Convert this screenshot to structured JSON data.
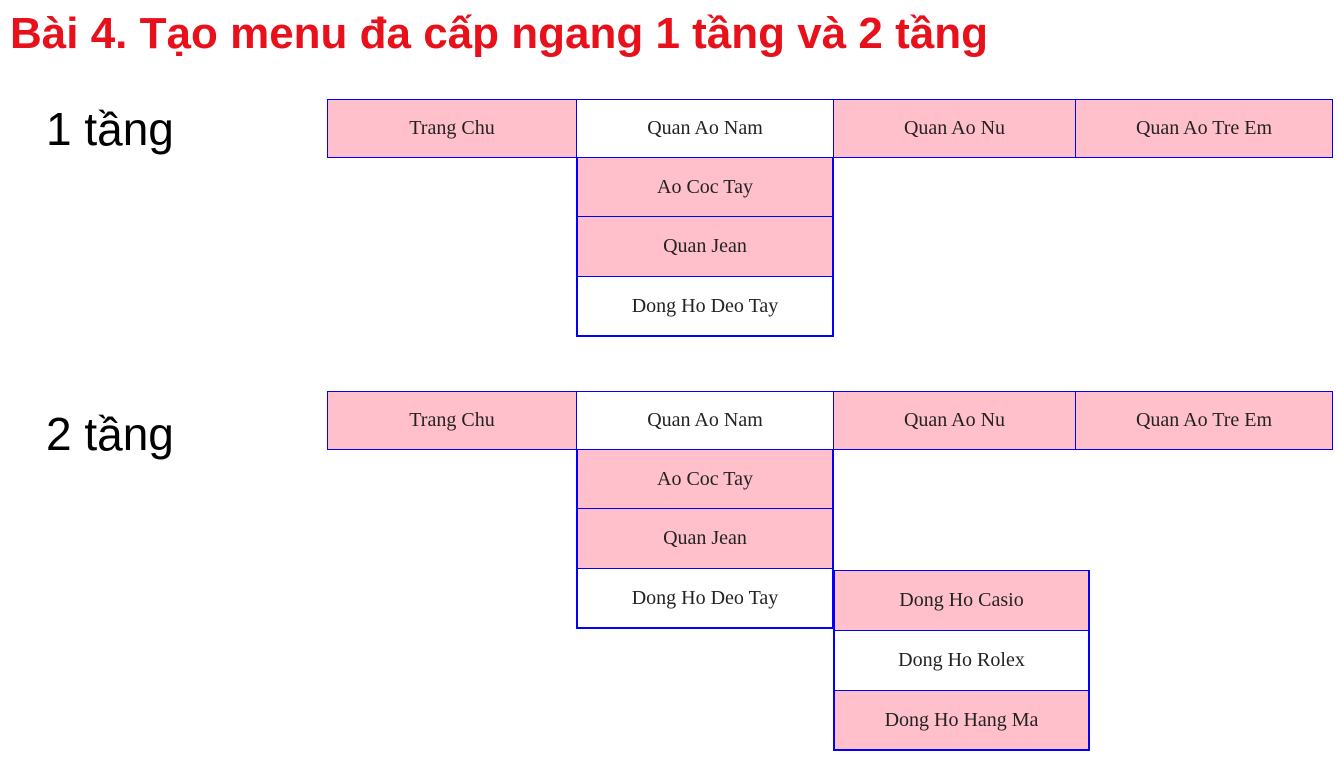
{
  "title": "Bài 4. Tạo menu đa cấp ngang 1 tầng và 2 tầng",
  "colors": {
    "title": "#e8101a",
    "border": "#0000ff",
    "item_pink": "#ffc0cb",
    "item_white": "#ffffff",
    "text": "#222222"
  },
  "section1": {
    "label": "1 tầng",
    "menu": [
      {
        "label": "Trang Chu",
        "highlight": true
      },
      {
        "label": "Quan Ao Nam",
        "highlight": false
      },
      {
        "label": "Quan Ao Nu",
        "highlight": true
      },
      {
        "label": "Quan Ao Tre Em",
        "highlight": true
      }
    ],
    "submenu": [
      {
        "label": "Ao Coc Tay",
        "highlight": true
      },
      {
        "label": "Quan Jean",
        "highlight": true
      },
      {
        "label": "Dong Ho Deo Tay",
        "highlight": false
      }
    ]
  },
  "section2": {
    "label": "2 tầng",
    "menu": [
      {
        "label": "Trang Chu",
        "highlight": true
      },
      {
        "label": "Quan Ao Nam",
        "highlight": false
      },
      {
        "label": "Quan Ao Nu",
        "highlight": true
      },
      {
        "label": "Quan Ao Tre Em",
        "highlight": true
      }
    ],
    "submenu": [
      {
        "label": "Ao Coc Tay",
        "highlight": true
      },
      {
        "label": "Quan Jean",
        "highlight": true
      },
      {
        "label": "Dong Ho Deo Tay",
        "highlight": false
      }
    ],
    "submenu2": [
      {
        "label": "Dong Ho Casio",
        "highlight": true
      },
      {
        "label": "Dong Ho Rolex",
        "highlight": false
      },
      {
        "label": "Dong Ho Hang Ma",
        "highlight": true
      }
    ]
  }
}
